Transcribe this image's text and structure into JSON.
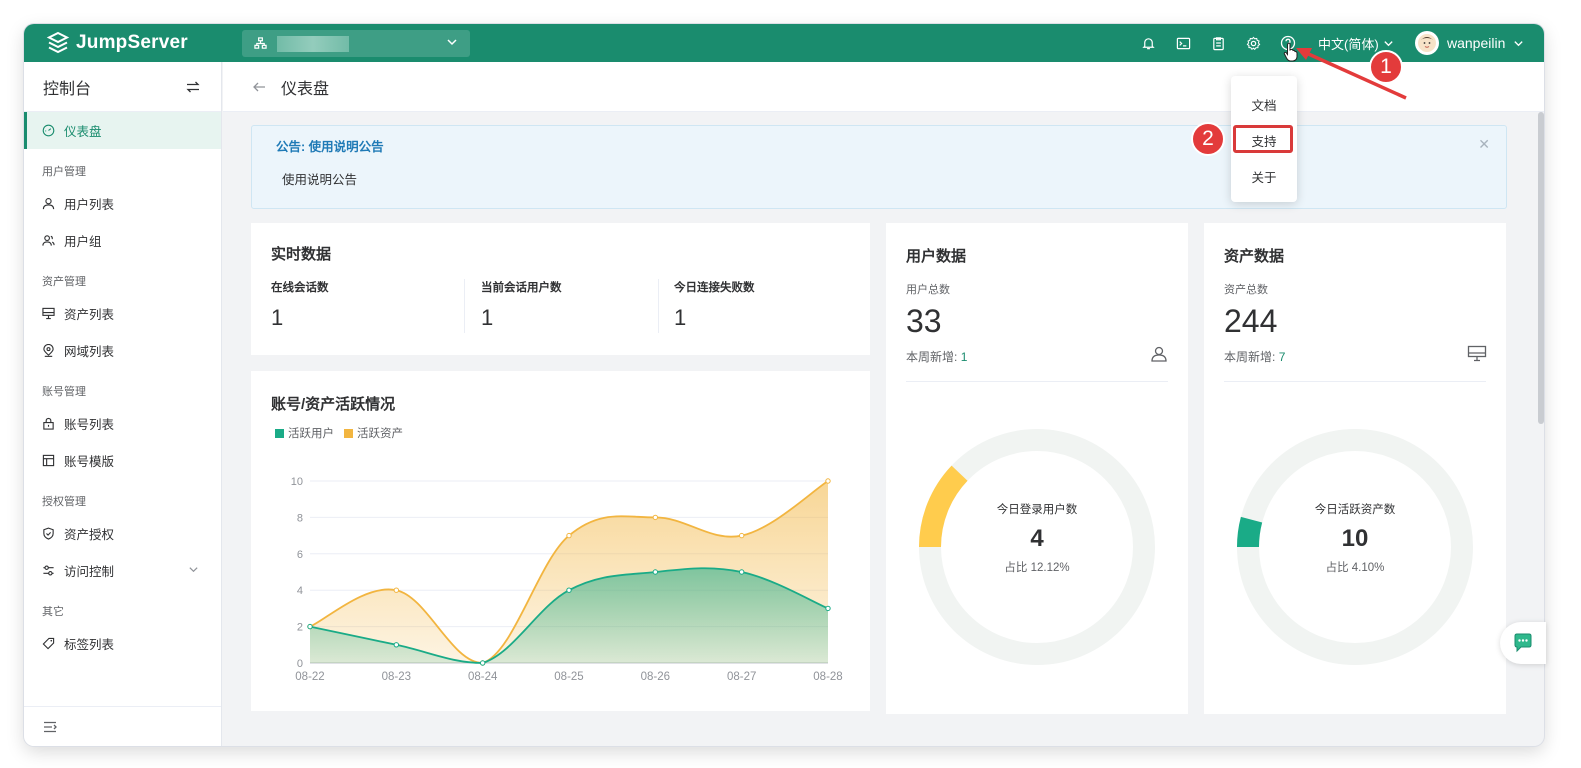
{
  "app": {
    "logo_text": "JumpServer",
    "lang": "中文(简体)",
    "username": "wanpeilin"
  },
  "sidebar": {
    "title": "控制台",
    "items": [
      {
        "type": "item",
        "label": "仪表盘",
        "icon": "dashboard-icon",
        "active": true
      },
      {
        "type": "group",
        "label": "用户管理"
      },
      {
        "type": "item",
        "label": "用户列表",
        "icon": "user-icon"
      },
      {
        "type": "item",
        "label": "用户组",
        "icon": "user-group-icon"
      },
      {
        "type": "group",
        "label": "资产管理"
      },
      {
        "type": "item",
        "label": "资产列表",
        "icon": "monitor-icon"
      },
      {
        "type": "item",
        "label": "网域列表",
        "icon": "location-icon"
      },
      {
        "type": "group",
        "label": "账号管理"
      },
      {
        "type": "item",
        "label": "账号列表",
        "icon": "lock-icon"
      },
      {
        "type": "item",
        "label": "账号模版",
        "icon": "template-icon"
      },
      {
        "type": "group",
        "label": "授权管理"
      },
      {
        "type": "item",
        "label": "资产授权",
        "icon": "shield-icon"
      },
      {
        "type": "item",
        "label": "访问控制",
        "icon": "access-control-icon",
        "expandable": true
      },
      {
        "type": "group",
        "label": "其它"
      },
      {
        "type": "item",
        "label": "标签列表",
        "icon": "tag-icon"
      }
    ]
  },
  "page": {
    "title": "仪表盘"
  },
  "notice": {
    "title": "公告: 使用说明公告",
    "body": "使用说明公告"
  },
  "realtime": {
    "title": "实时数据",
    "metrics": [
      {
        "label": "在线会话数",
        "value": "1"
      },
      {
        "label": "当前会话用户数",
        "value": "1"
      },
      {
        "label": "今日连接失败数",
        "value": "1"
      }
    ]
  },
  "user_data": {
    "title": "用户数据",
    "total_label": "用户总数",
    "total": "33",
    "weekly_label": "本周新增:",
    "weekly_value": "1",
    "donut_title": "今日登录用户数",
    "donut_value": "4",
    "donut_ratio": "占比 12.12%",
    "ratio": 0.1212,
    "color": "#ffcc4d"
  },
  "asset_data": {
    "title": "资产数据",
    "total_label": "资产总数",
    "total": "244",
    "weekly_label": "本周新增:",
    "weekly_value": "7",
    "donut_title": "今日活跃资产数",
    "donut_value": "10",
    "donut_ratio": "占比 4.10%",
    "ratio": 0.041,
    "color": "#1aab87"
  },
  "dropdown": {
    "items": [
      "文档",
      "支持",
      "关于"
    ],
    "highlighted": "支持"
  },
  "annotations": {
    "step1": "1",
    "step2": "2"
  },
  "chart_data": {
    "type": "area",
    "title": "账号/资产活跃情况",
    "categories": [
      "08-22",
      "08-23",
      "08-24",
      "08-25",
      "08-26",
      "08-27",
      "08-28"
    ],
    "yticks": [
      "0",
      "2",
      "4",
      "6",
      "8",
      "10"
    ],
    "ylim": [
      0,
      10
    ],
    "grid": true,
    "legend_position": "top-left",
    "series": [
      {
        "name": "活跃用户",
        "values": [
          2,
          1,
          0,
          4,
          5,
          5,
          3
        ],
        "color": "#1aab87"
      },
      {
        "name": "活跃资产",
        "values": [
          2,
          4,
          0,
          7,
          8,
          7,
          10
        ],
        "color": "#f2b540"
      }
    ]
  }
}
